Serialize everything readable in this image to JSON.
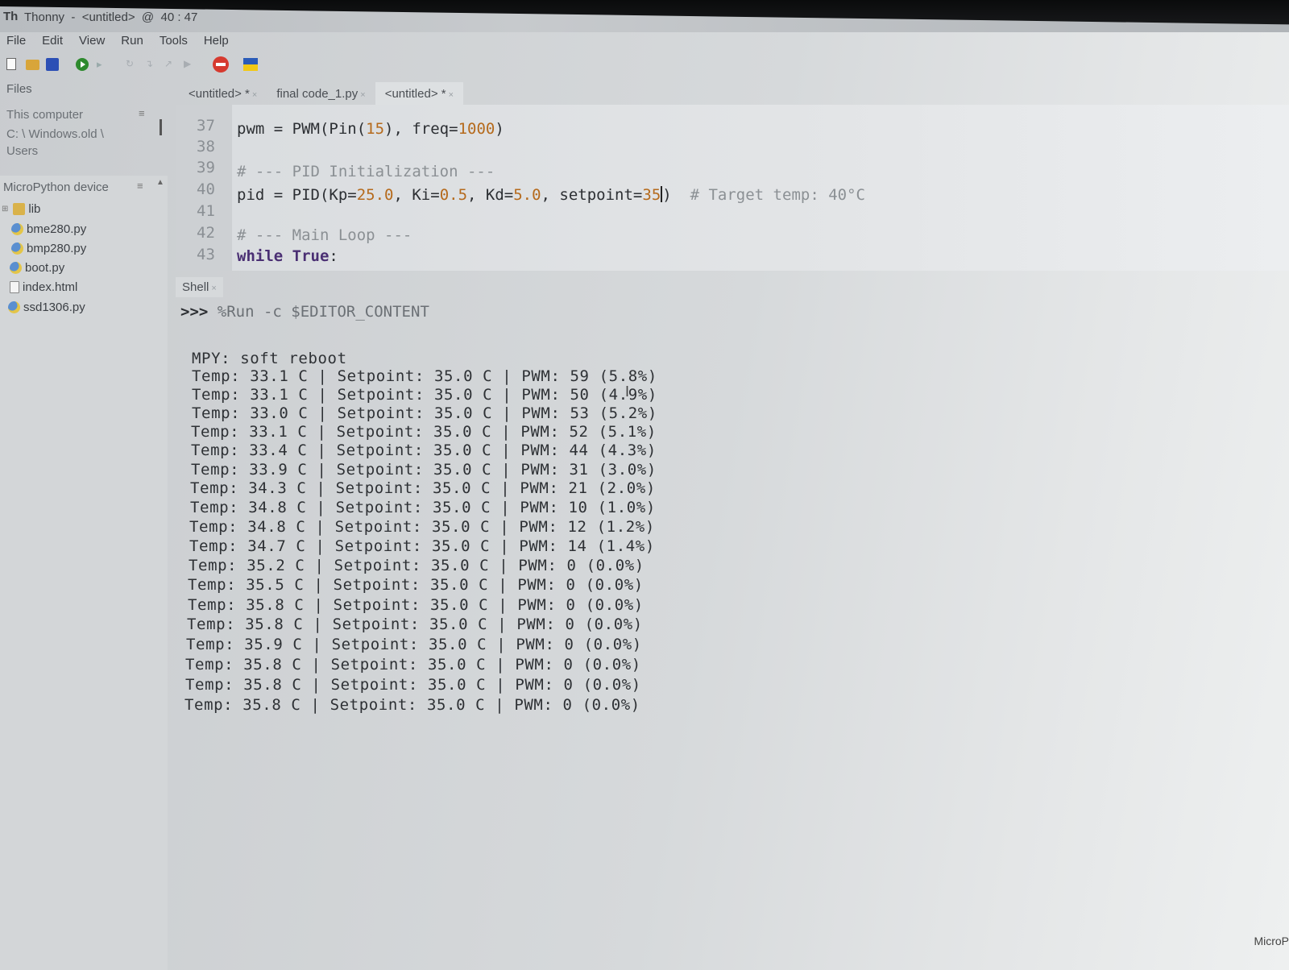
{
  "window": {
    "logo": "Th",
    "title": "Thonny  -  <untitled>  @  40 : 47"
  },
  "menu": [
    "File",
    "Edit",
    "View",
    "Run",
    "Tools",
    "Help"
  ],
  "files_panel": {
    "tab": "Files",
    "this_computer": {
      "header": "This computer",
      "path": "C: \\ Windows.old \\ Users"
    },
    "device": {
      "header": "MicroPython device",
      "items": [
        {
          "name": "lib",
          "icon": "folder-icon"
        },
        {
          "name": "bme280.py",
          "icon": "python-file-icon"
        },
        {
          "name": "bmp280.py",
          "icon": "python-file-icon"
        },
        {
          "name": "boot.py",
          "icon": "python-file-icon"
        },
        {
          "name": "index.html",
          "icon": "document-icon"
        },
        {
          "name": "ssd1306.py",
          "icon": "python-file-icon"
        }
      ]
    }
  },
  "editor": {
    "tabs": [
      {
        "label": "<untitled> *"
      },
      {
        "label": "final code_1.py"
      },
      {
        "label": "<untitled> *"
      }
    ],
    "lines": [
      {
        "n": "37",
        "text": "pwm = PWM(Pin(15), freq=1000)"
      },
      {
        "n": "38",
        "text": ""
      },
      {
        "n": "39",
        "text": "# --- PID Initialization ---"
      },
      {
        "n": "40",
        "text": "pid = PID(Kp=25.0, Ki=0.5, Kd=5.0, setpoint=35)  # Target temp: 40°C"
      },
      {
        "n": "41",
        "text": ""
      },
      {
        "n": "42",
        "text": "# --- Main Loop ---"
      },
      {
        "n": "43",
        "text": "while True:"
      }
    ]
  },
  "shell": {
    "tab": "Shell",
    "prompt": ">>>",
    "command": "%Run -c $EDITOR_CONTENT",
    "boot": "MPY: soft reboot",
    "rows": [
      "Temp: 33.1 C | Setpoint: 35.0 C | PWM: 59 (5.8%)",
      "Temp: 33.1 C | Setpoint: 35.0 C | PWM: 50 (4.9%)",
      "Temp: 33.0 C | Setpoint: 35.0 C | PWM: 53 (5.2%)",
      "Temp: 33.1 C | Setpoint: 35.0 C | PWM: 52 (5.1%)",
      "Temp: 33.4 C | Setpoint: 35.0 C | PWM: 44 (4.3%)",
      "Temp: 33.9 C | Setpoint: 35.0 C | PWM: 31 (3.0%)",
      "Temp: 34.3 C | Setpoint: 35.0 C | PWM: 21 (2.0%)",
      "Temp: 34.8 C | Setpoint: 35.0 C | PWM: 10 (1.0%)",
      "Temp: 34.8 C | Setpoint: 35.0 C | PWM: 12 (1.2%)",
      "Temp: 34.7 C | Setpoint: 35.0 C | PWM: 14 (1.4%)",
      "Temp: 35.2 C | Setpoint: 35.0 C | PWM: 0 (0.0%)",
      "Temp: 35.5 C | Setpoint: 35.0 C | PWM: 0 (0.0%)",
      "Temp: 35.8 C | Setpoint: 35.0 C | PWM: 0 (0.0%)",
      "Temp: 35.8 C | Setpoint: 35.0 C | PWM: 0 (0.0%)",
      "Temp: 35.9 C | Setpoint: 35.0 C | PWM: 0 (0.0%)",
      "Temp: 35.8 C | Setpoint: 35.0 C | PWM: 0 (0.0%)",
      "Temp: 35.8 C | Setpoint: 35.0 C | PWM: 0 (0.0%)",
      "Temp: 35.8 C | Setpoint: 35.0 C | PWM: 0 (0.0%)"
    ]
  },
  "status_bar": {
    "interpreter": "MicroP"
  }
}
